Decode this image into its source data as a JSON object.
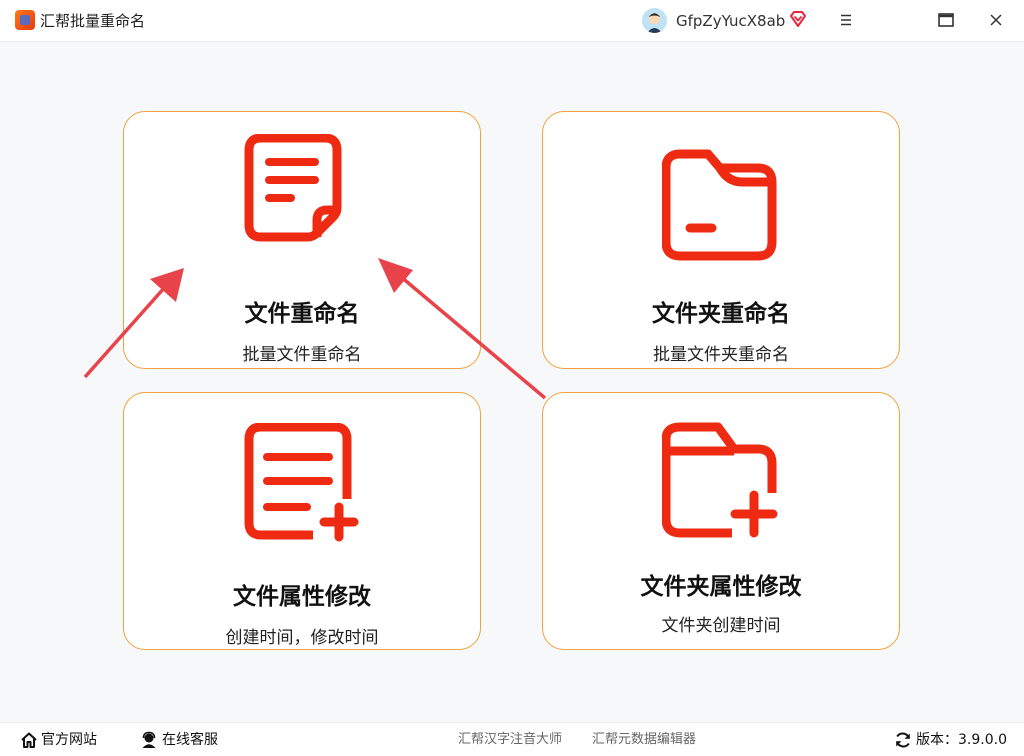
{
  "titlebar": {
    "app_title": "汇帮批量重命名",
    "username": "GfpZyYucX8ab",
    "icons": [
      "app-logo-icon",
      "avatar-icon",
      "vip-diamond-icon",
      "menu-icon",
      "maximize-icon",
      "close-icon"
    ]
  },
  "cards": [
    {
      "title": "文件重命名",
      "subtitle": "批量文件重命名",
      "icon": "document-icon"
    },
    {
      "title": "文件夹重命名",
      "subtitle": "批量文件夹重命名",
      "icon": "folder-icon"
    },
    {
      "title": "文件属性修改",
      "subtitle": "创建时间，修改时间",
      "icon": "document-add-icon"
    },
    {
      "title": "文件夹属性修改",
      "subtitle": "文件夹创建时间",
      "icon": "folder-add-icon"
    }
  ],
  "footer": {
    "website": "官方网站",
    "support": "在线客服",
    "link1": "汇帮汉字注音大师",
    "link2": "汇帮元数据编辑器",
    "version": "版本：3.9.0.0"
  },
  "colors": {
    "accent": "#f0a23c",
    "icon_red": "#ee2a12",
    "arrow": "#e8434a",
    "background": "#f7f8fa"
  }
}
